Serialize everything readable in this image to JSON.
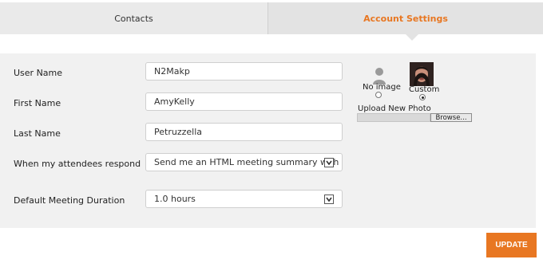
{
  "tabs": {
    "contacts": "Contacts",
    "account_settings": "Account Settings"
  },
  "form": {
    "user_name": {
      "label": "User Name",
      "value": "N2Makp"
    },
    "first_name": {
      "label": "First Name",
      "value": "AmyKelly"
    },
    "last_name": {
      "label": "Last Name",
      "value": "Petruzzella"
    },
    "attendees_respond": {
      "label": "When my attendees respond",
      "value": "Send me an HTML meeting summary with all re"
    },
    "meeting_duration": {
      "label": "Default Meeting Duration",
      "value": "1.0 hours"
    }
  },
  "photo": {
    "no_image_label": "No image",
    "custom_label": "Custom",
    "selected": "custom",
    "upload_label": "Upload New Photo",
    "browse_label": "Browse..."
  },
  "actions": {
    "update_label": "UPDATE"
  },
  "colors": {
    "accent": "#e87722",
    "panel_bg": "#f1f1f1",
    "tab_bg": "#e3e3e3"
  },
  "icons": {
    "dropdown": "chevron-down-icon",
    "default_avatar": "user-silhouette-icon"
  }
}
